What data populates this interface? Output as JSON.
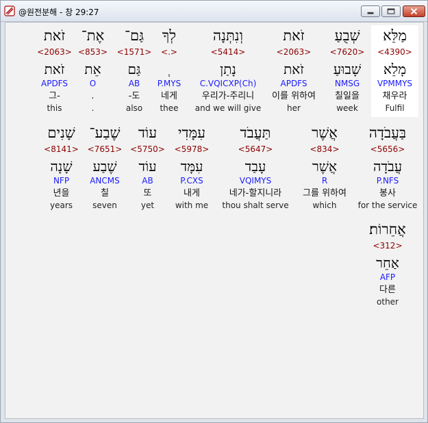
{
  "window": {
    "title": "@원전분해 - 창 29:27",
    "controls": {
      "minimize": "minimize-icon",
      "maximize": "maximize-icon",
      "close": "close-icon"
    }
  },
  "lines": [
    [
      {
        "heb": "מַלֵּא",
        "strong": "<4390>",
        "root": "מָלֵא",
        "morph": "VPMMYS",
        "kor": "채우라",
        "eng": "Fulfil",
        "selected": true
      },
      {
        "heb": "שְׁבֻעַ",
        "strong": "<7620>",
        "root": "שָׁבוּעַ",
        "morph": "NMSG",
        "kor": "칠일을",
        "eng": "week"
      },
      {
        "heb": "זֹאת",
        "strong": "<2063>",
        "root": "זֹאת",
        "morph": "APDFS",
        "kor": "이를 위하여",
        "eng": "her"
      },
      {
        "heb": "וְנִתְּנָה",
        "strong": "<5414>",
        "root": "נָתַן",
        "morph": "C.VQICXP(Ch)",
        "kor": "우리가-주리니",
        "eng": "and we will give"
      },
      {
        "heb": "לְךָ",
        "strong": "<.>",
        "root": "ְ",
        "morph": "P.MYS",
        "kor": "네게",
        "eng": "thee"
      },
      {
        "heb": "גַּם־",
        "strong": "<1571>",
        "root": "גַּם",
        "morph": "AB",
        "kor": "-도",
        "eng": "also"
      },
      {
        "heb": "אֶת־",
        "strong": "<853>",
        "root": "אֵת",
        "morph": "O",
        "kor": ".",
        "eng": "."
      },
      {
        "heb": "זֹאת",
        "strong": "<2063>",
        "root": "זֹאת",
        "morph": "APDFS",
        "kor": "그-",
        "eng": "this"
      }
    ],
    [
      {
        "heb": "בַּעֲבֹדָה",
        "strong": "<5656>",
        "root": "עֲבֹדָה",
        "morph": "P.NFS",
        "kor": "봉사",
        "eng": "for the service"
      },
      {
        "heb": "אֲשֶׁר",
        "strong": "<834>",
        "root": "אֲשֶׁר",
        "morph": "R",
        "kor": "그를 위하여",
        "eng": "which"
      },
      {
        "heb": "תַּעֲבֹד",
        "strong": "<5647>",
        "root": "עָבַד",
        "morph": "VQIMYS",
        "kor": "네가-할지니라",
        "eng": "thou shalt serve"
      },
      {
        "heb": "עִמָּדִי",
        "strong": "<5978>",
        "root": "עִמָּד",
        "morph": "P.CXS",
        "kor": "내게",
        "eng": "with me"
      },
      {
        "heb": "עוֹד",
        "strong": "<5750>",
        "root": "עוֹד",
        "morph": "AB",
        "kor": "또",
        "eng": "yet"
      },
      {
        "heb": "שֶׁבַע־",
        "strong": "<7651>",
        "root": "שֶׁבַע",
        "morph": "ANCMS",
        "kor": "칠",
        "eng": "seven"
      },
      {
        "heb": "שָׁנִים",
        "strong": "<8141>",
        "root": "שָׁנָה",
        "morph": "NFP",
        "kor": "년을",
        "eng": "years"
      }
    ],
    [
      {
        "heb": "אֲחֵרוֹת׃",
        "strong": "<312>",
        "root": "אַחֵר",
        "morph": "AFP",
        "kor": "다른",
        "eng": "other"
      }
    ]
  ]
}
